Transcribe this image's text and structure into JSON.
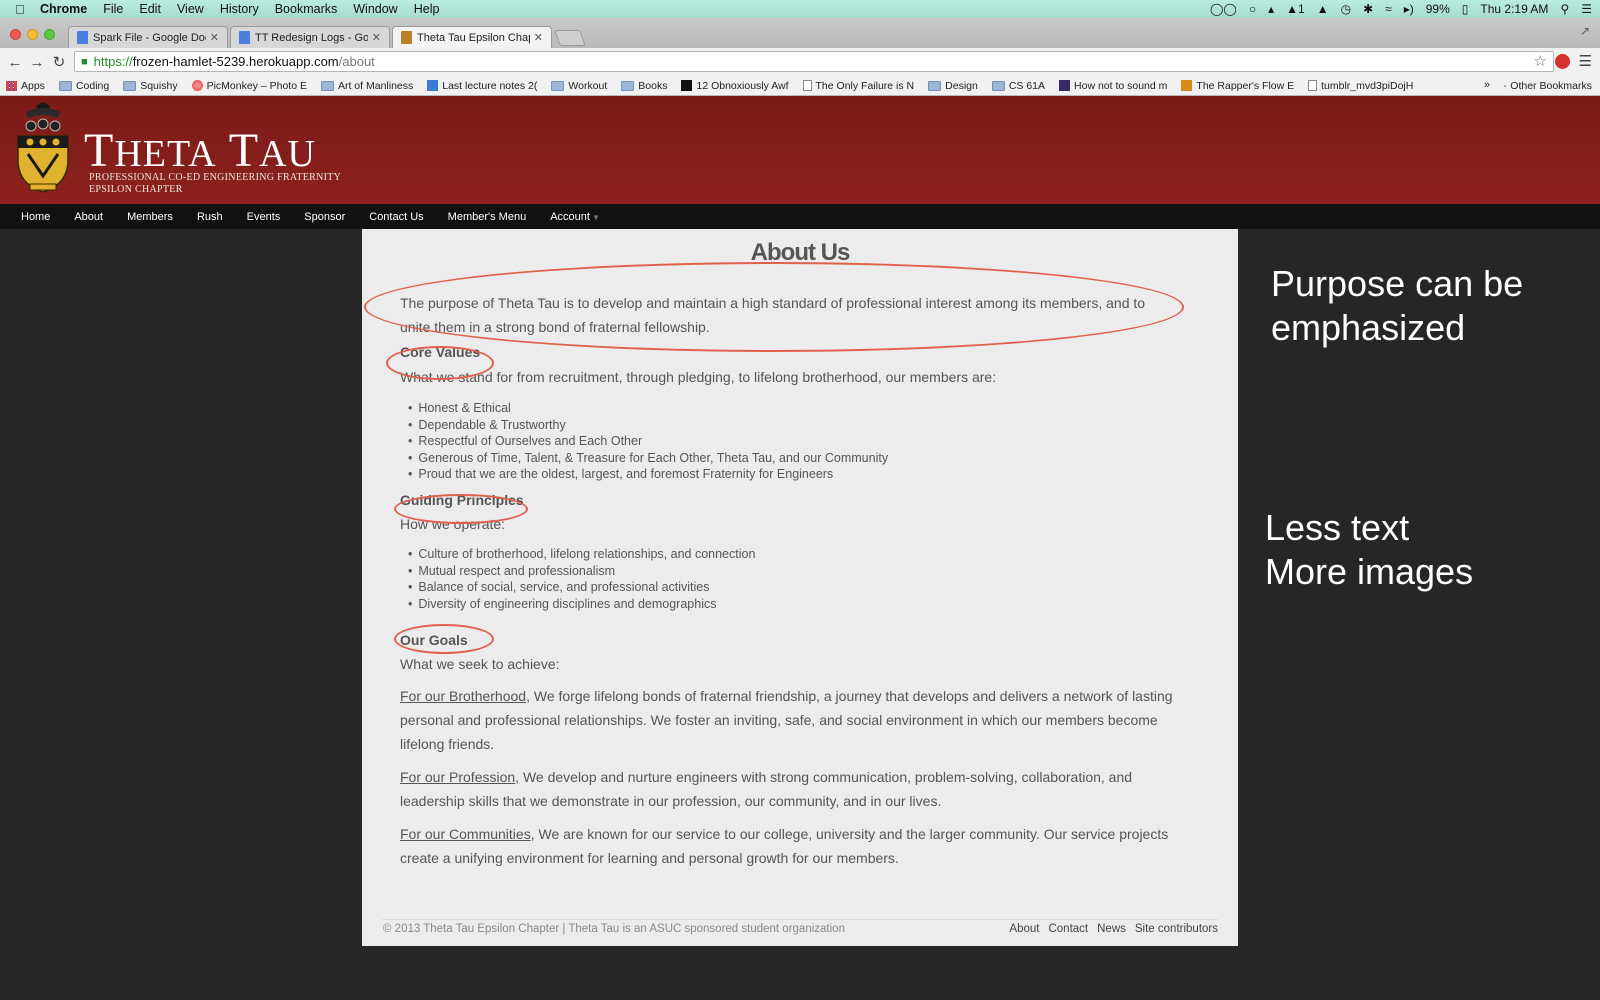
{
  "menubar": {
    "app": "Chrome",
    "items": [
      "File",
      "Edit",
      "View",
      "History",
      "Bookmarks",
      "Window",
      "Help"
    ],
    "adobe_count": "1",
    "battery": "99%",
    "clock": "Thu 2:19 AM"
  },
  "tabs": [
    {
      "title": "Spark File - Google Docs",
      "icon": "google-docs-icon"
    },
    {
      "title": "TT Redesign Logs - Googl",
      "icon": "google-docs-icon"
    },
    {
      "title": "Theta Tau Epsilon Chapter",
      "icon": "theta-tau-crest-icon",
      "active": true
    }
  ],
  "address": {
    "protocol": "https://",
    "host": "frozen-hamlet-5239.herokuapp.com",
    "path": "/about"
  },
  "bookmarks": [
    {
      "label": "Apps",
      "icon": "grid"
    },
    {
      "label": "Coding",
      "icon": "folder"
    },
    {
      "label": "Squishy",
      "icon": "folder"
    },
    {
      "label": "PicMonkey – Photo E",
      "icon": "pic"
    },
    {
      "label": "Art of Manliness",
      "icon": "folder"
    },
    {
      "label": "Last lecture notes 2(",
      "icon": "blue"
    },
    {
      "label": "Workout",
      "icon": "folder"
    },
    {
      "label": "Books",
      "icon": "folder"
    },
    {
      "label": "12 Obnoxiously Awf",
      "icon": "dark"
    },
    {
      "label": "The Only Failure is N",
      "icon": "page"
    },
    {
      "label": "Design",
      "icon": "folder"
    },
    {
      "label": "CS 61A",
      "icon": "folder"
    },
    {
      "label": "How not to sound m",
      "icon": "purple"
    },
    {
      "label": "The Rapper's Flow E",
      "icon": "orange"
    },
    {
      "label": "tumblr_mvd3piDojH",
      "icon": "page"
    }
  ],
  "bookmarks_more": "»",
  "bookmarks_other": "Other Bookmarks",
  "site": {
    "title_first": "T",
    "title_first_rest": "HETA",
    "title_second": "T",
    "title_second_rest": "AU",
    "subtitle1": "PROFESSIONAL CO-ED ENGINEERING FRATERNITY",
    "subtitle2": "EPSILON CHAPTER",
    "nav": [
      "Home",
      "About",
      "Members",
      "Rush",
      "Events",
      "Sponsor",
      "Contact Us",
      "Member's Menu",
      "Account"
    ],
    "accent": "#8a201c"
  },
  "content": {
    "title": "About Us",
    "purpose": "The purpose of Theta Tau is to develop and maintain a high standard of professional interest among its members, and to unite them in a strong bond of fraternal fellowship.",
    "core_values": {
      "heading": "Core Values",
      "intro": "What we stand for from recruitment, through pledging, to lifelong brotherhood, our members are:",
      "items": [
        "Honest & Ethical",
        "Dependable & Trustworthy",
        "Respectful of Ourselves and Each Other",
        "Generous of Time, Talent, & Treasure for Each Other, Theta Tau, and our Community",
        "Proud that we are the oldest, largest, and foremost Fraternity for Engineers"
      ]
    },
    "guiding_principles": {
      "heading": "Guiding Principles",
      "intro": "How we operate:",
      "items": [
        "Culture of brotherhood, lifelong relationships, and connection",
        "Mutual respect and professionalism",
        "Balance of social, service, and professional activities",
        "Diversity of engineering disciplines and demographics"
      ]
    },
    "goals": {
      "heading": "Our Goals",
      "intro": "What we seek to achieve:",
      "items": [
        {
          "label": "For our Brotherhood",
          "text": ", We forge lifelong bonds of fraternal friendship, a journey that develops and delivers a network of lasting personal and professional relationships. We foster an inviting, safe, and social environment in which our members become lifelong friends."
        },
        {
          "label": "For our Profession",
          "text": ", We develop and nurture engineers with strong communication, problem-solving, collaboration, and leadership skills that we demonstrate in our profession, our community, and in our lives."
        },
        {
          "label": "For our Communities",
          "text": ", We are known for our service to our college, university and the larger community. Our service projects create a unifying environment for learning and personal growth for our members."
        }
      ]
    },
    "footer": {
      "copyright": "© 2013 Theta Tau Epsilon Chapter | Theta Tau is an ASUC sponsored student organization",
      "links": [
        "About",
        "Contact",
        "News",
        "Site contributors"
      ]
    }
  },
  "annotations": {
    "note1_line1": "Purpose can be",
    "note1_line2": "emphasized",
    "note2_line1": "Less text",
    "note2_line2": "More images",
    "oval_color": "#e0604b"
  }
}
